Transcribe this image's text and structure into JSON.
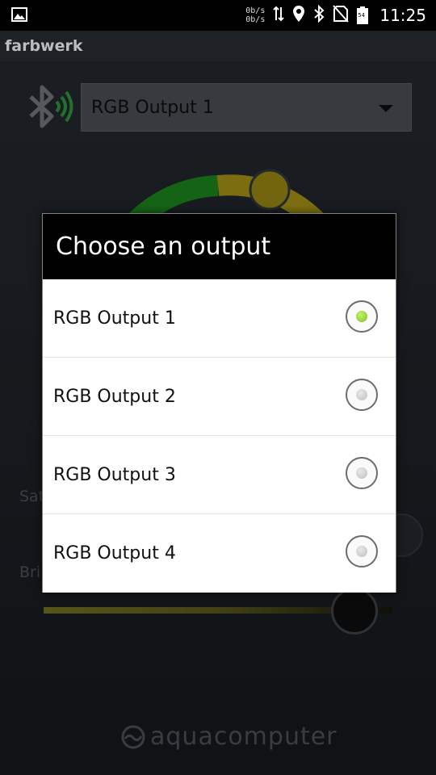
{
  "status_bar": {
    "net_up": "0b/s",
    "net_down": "0b/s",
    "battery": "54",
    "time": "11:25",
    "icons": [
      "image-icon",
      "data-transfer-icon",
      "location-icon",
      "bluetooth-icon",
      "no-sim-icon",
      "battery-icon"
    ]
  },
  "app": {
    "title": "farbwerk"
  },
  "background": {
    "output_select_value": "RGB Output 1",
    "saturation_label": "Sat",
    "brightness_label": "Bri",
    "brand": "aquacomputer",
    "accent_colors": {
      "wheel_green": "#22b022",
      "wheel_yellow": "#d9c21a",
      "brightness_track": "#8a8a2a"
    }
  },
  "dialog": {
    "title": "Choose an output",
    "options": [
      {
        "label": "RGB Output 1",
        "selected": true
      },
      {
        "label": "RGB Output 2",
        "selected": false
      },
      {
        "label": "RGB Output 3",
        "selected": false
      },
      {
        "label": "RGB Output 4",
        "selected": false
      }
    ],
    "selected_color": "#7cc31d"
  }
}
